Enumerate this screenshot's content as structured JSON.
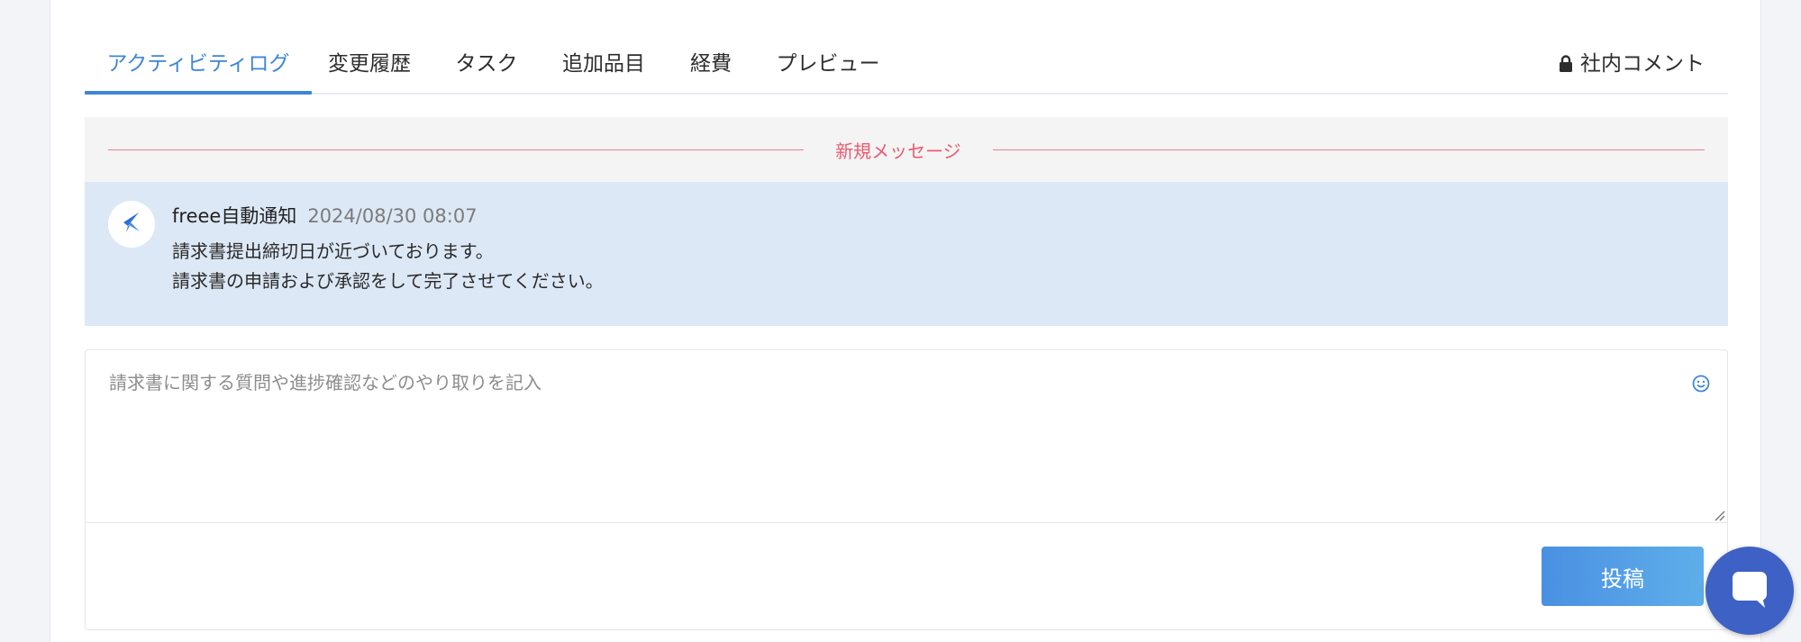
{
  "tabs": {
    "items": [
      {
        "label": "アクティビティログ",
        "active": true
      },
      {
        "label": "変更履歴",
        "active": false
      },
      {
        "label": "タスク",
        "active": false
      },
      {
        "label": "追加品目",
        "active": false
      },
      {
        "label": "経費",
        "active": false
      },
      {
        "label": "プレビュー",
        "active": false
      }
    ],
    "internal_comment_label": "社内コメント",
    "internal_comment_icon": "lock-icon"
  },
  "new_message_divider": {
    "label": "新規メッセージ"
  },
  "message": {
    "sender": "freee自動通知",
    "timestamp": "2024/08/30 08:07",
    "lines": [
      "請求書提出締切日が近づいております。",
      "請求書の申請および承認をして完了させてください。"
    ],
    "avatar_icon": "freee-logo-icon"
  },
  "composer": {
    "placeholder": "請求書に関する質問や進捗確認などのやり取りを記入",
    "emoji_icon": "smiley-icon",
    "post_label": "投稿"
  },
  "chat_widget": {
    "icon": "chat-bubble-icon"
  },
  "colors": {
    "accent": "#3f86d6",
    "new_message": "#ea5b70",
    "message_bg": "#dde8f6",
    "post_button": "#4a90e2",
    "chat_fab": "#3d61c4"
  }
}
